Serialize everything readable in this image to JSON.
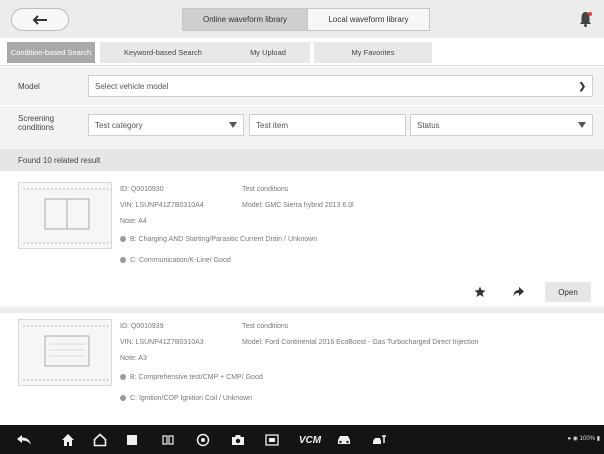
{
  "header": {
    "tab_online": "Online waveform library",
    "tab_local": "Local waveform library"
  },
  "tabs": [
    {
      "label": "Condition-based Search",
      "active": true
    },
    {
      "label": "Keyword-based Search",
      "active": false
    },
    {
      "label": "My Upload",
      "active": false
    },
    {
      "label": "My Favorites",
      "active": false
    }
  ],
  "model": {
    "label": "Model",
    "placeholder": "Select vehicle model"
  },
  "screening": {
    "label": "Screening conditions",
    "test_category": "Test category",
    "test_item": "Test item",
    "status": "Status"
  },
  "results": {
    "found_text": "Found 10 related result",
    "items": [
      {
        "id": "ID: Q0010930",
        "vin": "VIN: LSUNP41Z7B0310A4",
        "note": "Note: A4",
        "test_conditions_label": "Test conditions",
        "model": "Model: GMC Sierra hybrid 2013 6.0l",
        "channel_b": "B: Charging AND Starting/Parasitic Current Drain / Unknown",
        "channel_c": "C: Communication/K-Line/ Good",
        "open_label": "Open"
      },
      {
        "id": "ID: Q0010939",
        "vin": "VIN: LSUNP41Z7B0310A3",
        "note": "Note: A3",
        "test_conditions_label": "Test conditions",
        "model": "Model: Ford Continental 2016 EcoBoost - Gas Turbocharged Direct Injection",
        "channel_b": "B: Comprehensive test/CMP + CMP/ Good",
        "channel_c": "C: Ignition/COP Ignition Coil / Unknown"
      }
    ]
  },
  "navbar": {
    "vci_label": "VCM",
    "status_text": "100%"
  }
}
